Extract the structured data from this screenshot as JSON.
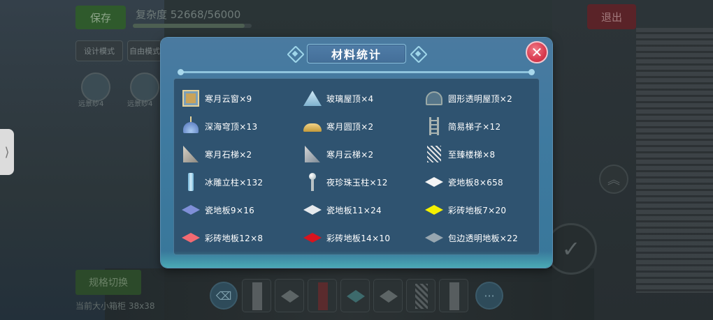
{
  "hud": {
    "save_label": "保存",
    "complexity_text": "复杂度 52668/56000",
    "complexity_progress": 0.94,
    "exit_label": "退出",
    "mode_design_label": "设计模式",
    "mode_free_label": "自由模式",
    "avatar_labels": [
      "远景纱4",
      "远景纱4"
    ],
    "side_tab_glyph": "⟩",
    "up_glyph": "︽",
    "confirm_glyph": "✓",
    "spec_switch_label": "规格切换",
    "grid_size_text": "当前大小箱柜 38x38",
    "toolbar_more": "···"
  },
  "dialog": {
    "title": "材料统计",
    "close_glyph": "✕",
    "materials": [
      {
        "label": "寒月云窗×9",
        "icon": "window-icon"
      },
      {
        "label": "玻璃屋顶×4",
        "icon": "glass-pyramid-icon"
      },
      {
        "label": "圆形透明屋顶×2",
        "icon": "round-glass-roof-icon"
      },
      {
        "label": "深海穹顶×13",
        "icon": "deep-sea-dome-icon"
      },
      {
        "label": "寒月圆顶×2",
        "icon": "gold-dome-icon"
      },
      {
        "label": "简易梯子×12",
        "icon": "ladder-icon"
      },
      {
        "label": "寒月石梯×2",
        "icon": "stone-slope-icon"
      },
      {
        "label": "寒月云梯×2",
        "icon": "cloud-slope-icon"
      },
      {
        "label": "至臻楼梯×8",
        "icon": "stairs-icon"
      },
      {
        "label": "冰雕立柱×132",
        "icon": "ice-column-icon"
      },
      {
        "label": "夜珍珠玉柱×12",
        "icon": "pearl-pillar-icon"
      },
      {
        "label": "瓷地板8×658",
        "icon": "white-tile-icon"
      },
      {
        "label": "瓷地板9×16",
        "icon": "blue-tile-icon"
      },
      {
        "label": "瓷地板11×24",
        "icon": "light-tile-icon"
      },
      {
        "label": "彩砖地板7×20",
        "icon": "yellow-tile-icon"
      },
      {
        "label": "彩砖地板12×8",
        "icon": "pink-tile-icon"
      },
      {
        "label": "彩砖地板14×10",
        "icon": "red-tile-icon"
      },
      {
        "label": "包边透明地板×22",
        "icon": "gray-tile-icon"
      }
    ]
  },
  "colors": {
    "blue_tile": "#7f8fd8",
    "light_tile": "#e6eaee",
    "white_tile": "#f4f4f4",
    "yellow_tile": "#f4f000",
    "pink_tile": "#f36a72",
    "red_tile": "#d8141e",
    "gray_tile": "#97a6b0"
  }
}
